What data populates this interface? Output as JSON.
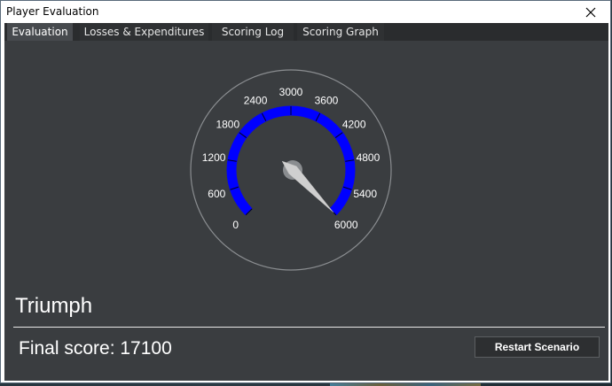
{
  "window": {
    "title": "Player Evaluation"
  },
  "tabs": [
    {
      "label": "Evaluation",
      "active": true
    },
    {
      "label": "Losses & Expenditures",
      "active": false
    },
    {
      "label": "Scoring Log",
      "active": false
    },
    {
      "label": "Scoring Graph",
      "active": false
    }
  ],
  "gauge": {
    "min": 0,
    "max": 6000,
    "ticks": [
      "0",
      "600",
      "1200",
      "1800",
      "2400",
      "3000",
      "3600",
      "4200",
      "4800",
      "5400",
      "6000"
    ],
    "needle_value": 6000,
    "arc_color": "#0000ff",
    "needle_color": "#cfcfcf"
  },
  "result": {
    "title": "Triumph",
    "score_text": "Final score: 17100",
    "restart_label": "Restart Scenario"
  },
  "icons": {
    "close": "close-icon"
  }
}
